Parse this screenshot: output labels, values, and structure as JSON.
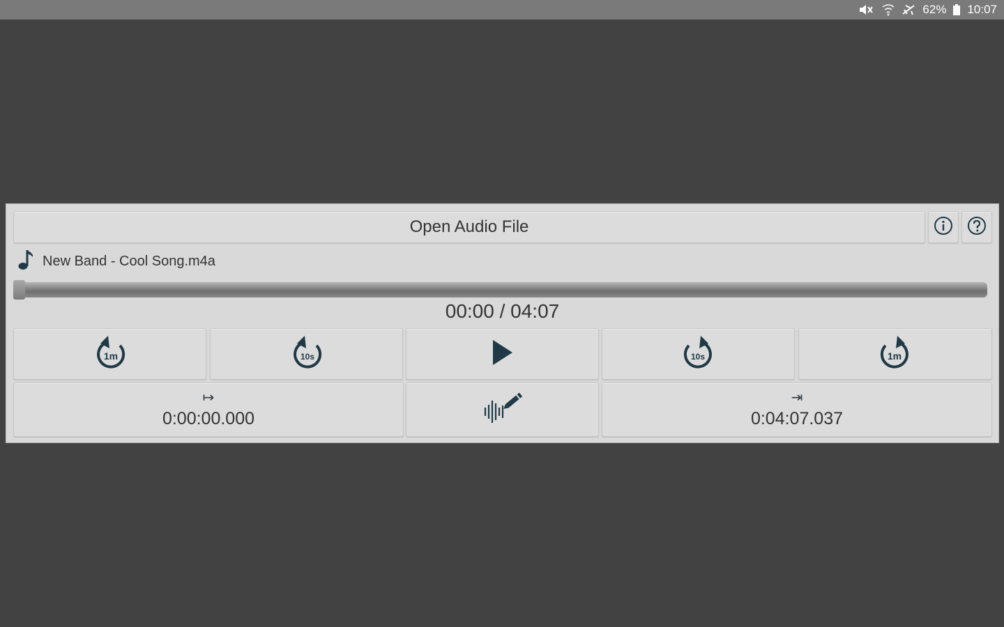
{
  "status_bar": {
    "battery": "62%",
    "clock": "10:07",
    "icons": [
      "mute-icon",
      "wifi-icon",
      "airplane-icon",
      "battery-icon"
    ]
  },
  "toolbar": {
    "open_label": "Open Audio File",
    "info_icon": "info-icon",
    "help_icon": "help-icon"
  },
  "file": {
    "name": "New Band - Cool Song.m4a",
    "icon": "music-note-icon"
  },
  "playback": {
    "position_text": "00:00 / 04:07",
    "progress": 0
  },
  "controls": {
    "back_1m": "1m",
    "back_10s": "10s",
    "forward_10s": "10s",
    "forward_1m": "1m"
  },
  "markers": {
    "start_arrow": "↦",
    "start_value": "0:00:00.000",
    "end_arrow": "⇥",
    "end_value": "0:04:07.037"
  },
  "colors": {
    "background": "#424242",
    "panel": "#d9d9d9",
    "icon": "#1f3947"
  }
}
